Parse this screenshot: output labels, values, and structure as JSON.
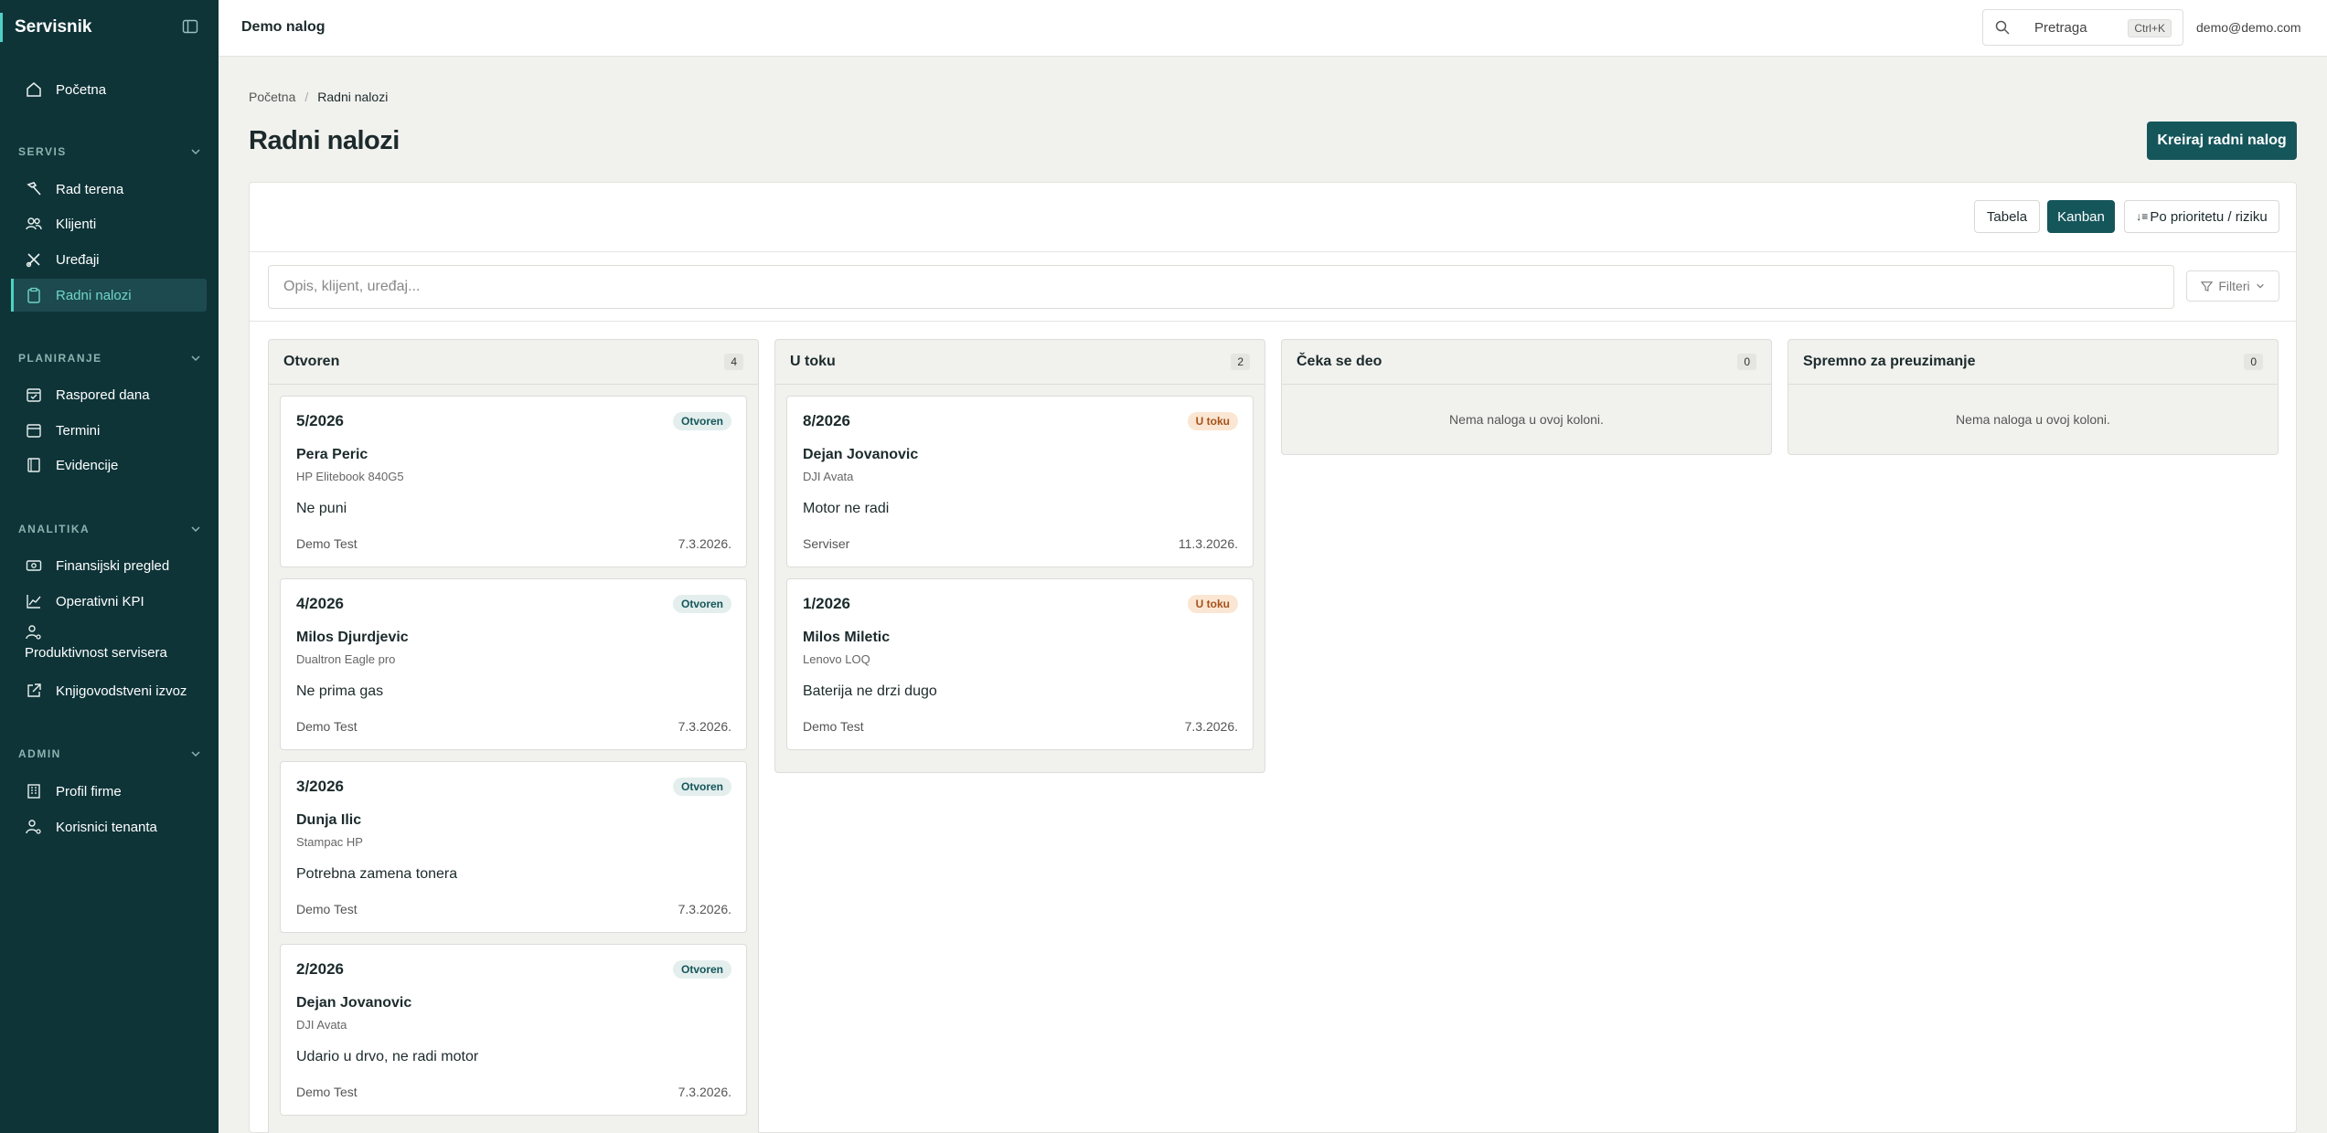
{
  "sidebar": {
    "brand": "Servisnik",
    "home": "Početna",
    "sections": {
      "servis": "SERVIS",
      "planiranje": "PLANIRANJE",
      "analitika": "ANALITIKA",
      "admin": "ADMIN"
    },
    "items": {
      "rad_terena": "Rad terena",
      "klijenti": "Klijenti",
      "uredjaji": "Uređaji",
      "radni_nalozi": "Radni nalozi",
      "raspored_dana": "Raspored dana",
      "termini": "Termini",
      "evidencije": "Evidencije",
      "finansijski_pregled": "Finansijski pregled",
      "operativni_kpi": "Operativni KPI",
      "produktivnost": "Produktivnost servisera",
      "knjigovodstveni_izvoz": "Knjigovodstveni izvoz",
      "profil_firme": "Profil firme",
      "korisnici_tenanta": "Korisnici tenanta"
    }
  },
  "topbar": {
    "account": "Demo nalog",
    "search_label": "Pretraga",
    "search_shortcut": "Ctrl+K",
    "user_email": "demo@demo.com"
  },
  "breadcrumb": {
    "home": "Početna",
    "current": "Radni nalozi"
  },
  "page": {
    "title": "Radni nalozi",
    "create_button": "Kreiraj radni nalog"
  },
  "toolbar": {
    "table": "Tabela",
    "kanban": "Kanban",
    "sort": "Po prioritetu / riziku"
  },
  "filter": {
    "placeholder": "Opis, klijent, uređaj...",
    "filters_button": "Filteri"
  },
  "empty_text": "Nema naloga u ovoj koloni.",
  "columns": [
    {
      "title": "Otvoren",
      "count": "4",
      "cards": [
        {
          "num": "5/2026",
          "status": "Otvoren",
          "client": "Pera Peric",
          "device": "HP Elitebook 840G5",
          "desc": "Ne puni",
          "tech": "Demo Test",
          "date": "7.3.2026."
        },
        {
          "num": "4/2026",
          "status": "Otvoren",
          "client": "Milos Djurdjevic",
          "device": "Dualtron Eagle pro",
          "desc": "Ne prima gas",
          "tech": "Demo Test",
          "date": "7.3.2026."
        },
        {
          "num": "3/2026",
          "status": "Otvoren",
          "client": "Dunja Ilic",
          "device": "Stampac HP",
          "desc": "Potrebna zamena tonera",
          "tech": "Demo Test",
          "date": "7.3.2026."
        },
        {
          "num": "2/2026",
          "status": "Otvoren",
          "client": "Dejan Jovanovic",
          "device": "DJI Avata",
          "desc": "Udario u drvo, ne radi motor",
          "tech": "Demo Test",
          "date": "7.3.2026."
        }
      ]
    },
    {
      "title": "U toku",
      "count": "2",
      "cards": [
        {
          "num": "8/2026",
          "status": "U toku",
          "client": "Dejan Jovanovic",
          "device": "DJI Avata",
          "desc": "Motor ne radi",
          "tech": "Serviser",
          "date": "11.3.2026."
        },
        {
          "num": "1/2026",
          "status": "U toku",
          "client": "Milos Miletic",
          "device": "Lenovo LOQ",
          "desc": "Baterija ne drzi dugo",
          "tech": "Demo Test",
          "date": "7.3.2026."
        }
      ]
    },
    {
      "title": "Čeka se deo",
      "count": "0",
      "cards": []
    },
    {
      "title": "Spremno za preuzimanje",
      "count": "0",
      "cards": []
    }
  ]
}
